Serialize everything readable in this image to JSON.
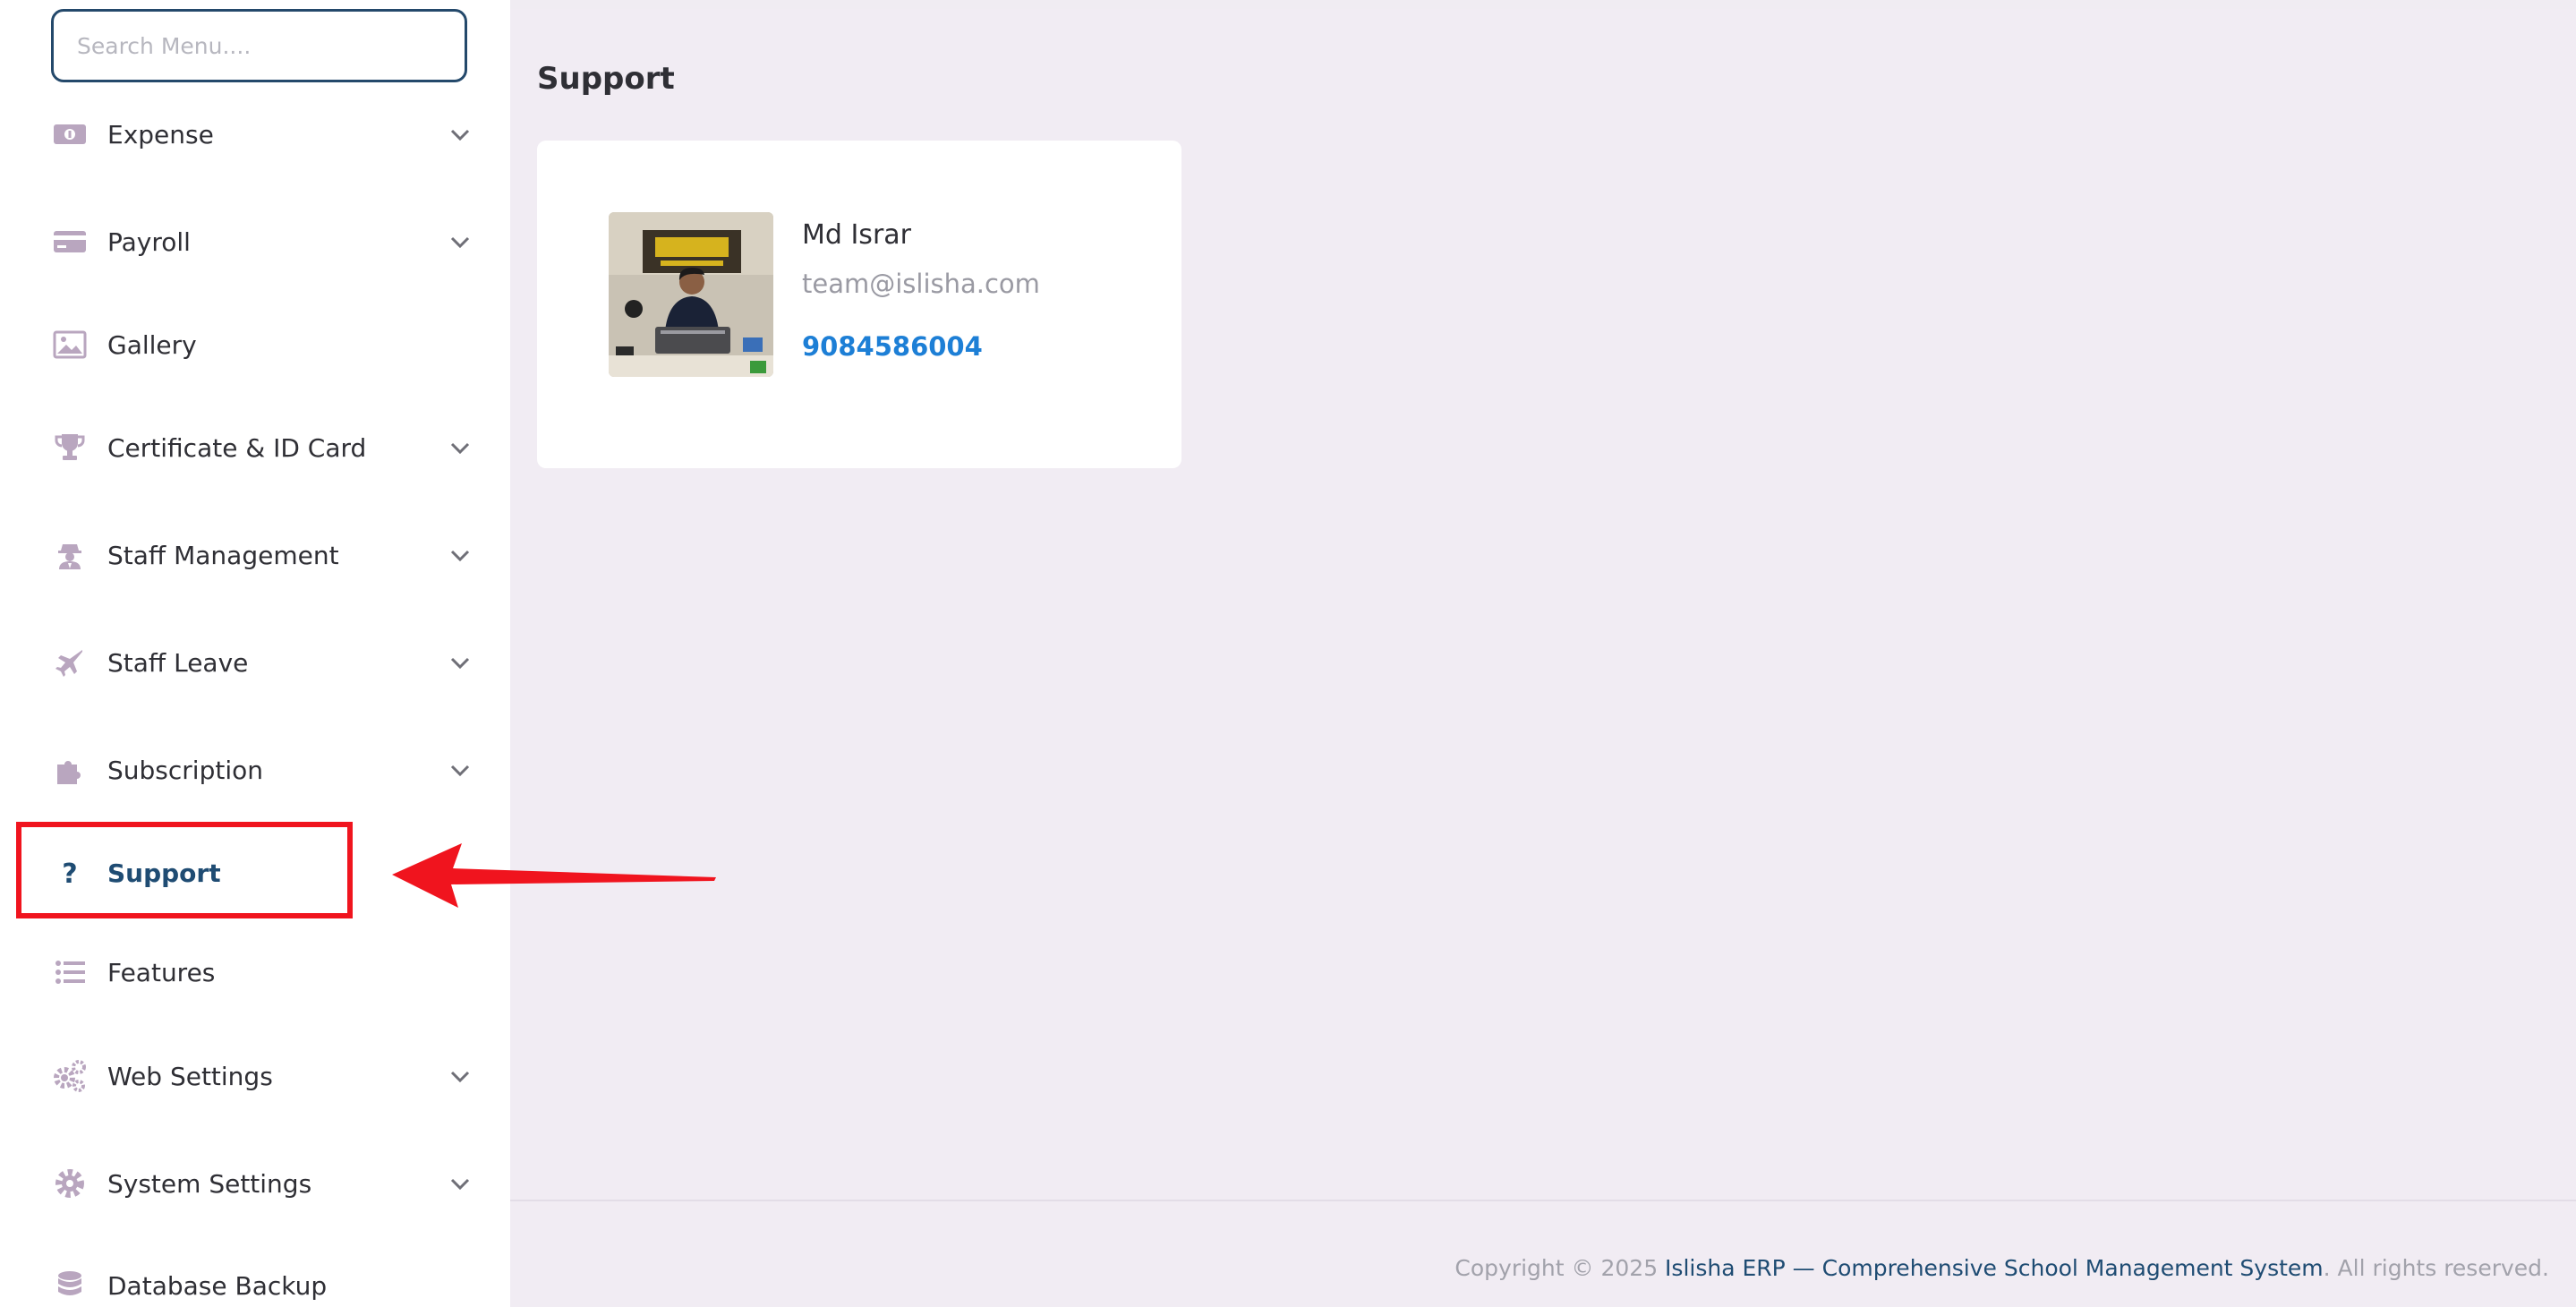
{
  "search": {
    "placeholder": "Search Menu...."
  },
  "sidebar": {
    "items": [
      {
        "label": "Expense",
        "icon": "money-bill-icon",
        "has_submenu": true
      },
      {
        "label": "Payroll",
        "icon": "credit-card-icon",
        "has_submenu": true
      },
      {
        "label": "Gallery",
        "icon": "image-icon",
        "has_submenu": false
      },
      {
        "label": "Certificate & ID Card",
        "icon": "trophy-icon",
        "has_submenu": true
      },
      {
        "label": "Staff Management",
        "icon": "user-secret-icon",
        "has_submenu": true
      },
      {
        "label": "Staff Leave",
        "icon": "plane-icon",
        "has_submenu": true
      },
      {
        "label": "Subscription",
        "icon": "puzzle-icon",
        "has_submenu": true
      },
      {
        "label": "Support",
        "icon": "question-icon",
        "has_submenu": false,
        "active": true
      },
      {
        "label": "Features",
        "icon": "list-icon",
        "has_submenu": false
      },
      {
        "label": "Web Settings",
        "icon": "cogs-icon",
        "has_submenu": true
      },
      {
        "label": "System Settings",
        "icon": "gear-icon",
        "has_submenu": true
      },
      {
        "label": "Database Backup",
        "icon": "database-icon",
        "has_submenu": false
      }
    ]
  },
  "main": {
    "title": "Support",
    "contact": {
      "name": "Md Israr",
      "email": "team@islisha.com",
      "phone": "9084586004"
    }
  },
  "footer": {
    "prefix": "Copyright © 2025 ",
    "link": "Islisha ERP — Comprehensive School Management System",
    "suffix": ". All rights reserved."
  },
  "colors": {
    "accent": "#1f4c73",
    "icon": "#b9a6bf",
    "link": "#1d7fd6",
    "annotation": "#f0141e",
    "background": "#f1ecf3"
  }
}
